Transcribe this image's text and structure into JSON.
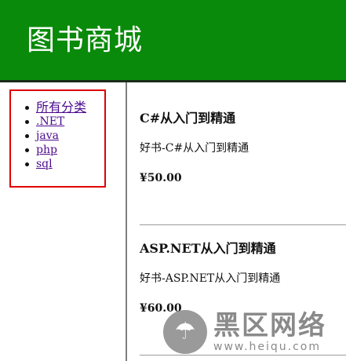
{
  "header": {
    "title": "图书商城",
    "background": "#0a8a0a"
  },
  "sidebar": {
    "categories": [
      {
        "label": "所有分类"
      },
      {
        "label": ".NET"
      },
      {
        "label": "java"
      },
      {
        "label": "php"
      },
      {
        "label": "sql"
      }
    ]
  },
  "books": [
    {
      "title": "C#从入门到精通",
      "desc": "好书-C#从入门到精通",
      "price": "¥50.00"
    },
    {
      "title": "ASP.NET从入门到精通",
      "desc": "好书-ASP.NET从入门到精通",
      "price": "¥60.00"
    }
  ],
  "watermark": {
    "brand": "黑区网络",
    "url": "www.heiqu.com",
    "icon": "mushroom-logo-icon"
  }
}
